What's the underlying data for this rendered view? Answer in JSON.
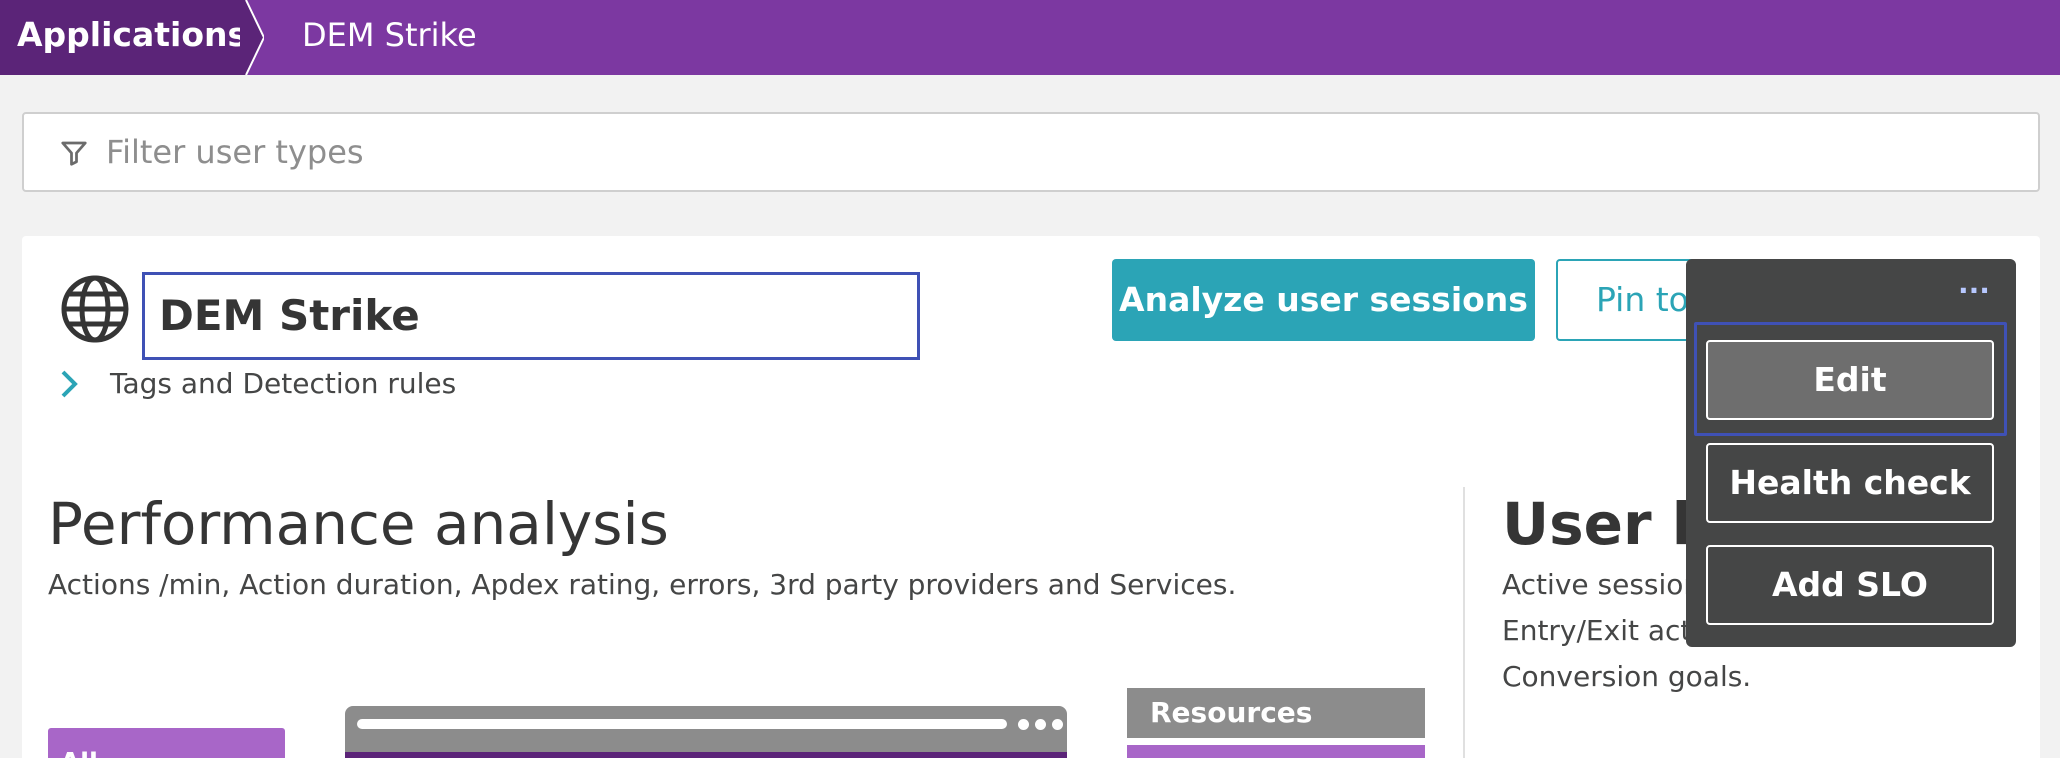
{
  "breadcrumb": {
    "root": "Applications",
    "current": "DEM Strike"
  },
  "filter": {
    "placeholder": "Filter user types",
    "value": ""
  },
  "app": {
    "name": "DEM Strike",
    "tags_label": "Tags and Detection rules"
  },
  "actions": {
    "analyze_label": "Analyze user sessions",
    "pin_label": "Pin to"
  },
  "performance": {
    "title": "Performance analysis",
    "description": "Actions /min, Action duration, Apdex rating, errors, 3rd party providers and Services."
  },
  "user_behavior": {
    "title": "User be",
    "lines": [
      "Active session",
      "Entry/Exit act",
      "Conversion goals."
    ]
  },
  "illustration": {
    "left_label": "All",
    "resources_label": "Resources"
  },
  "menu": {
    "more_glyph": "···",
    "items": [
      "Edit",
      "Health check",
      "Add SLO"
    ]
  },
  "colors": {
    "brand_purple": "#7c38a1",
    "brand_purple_dark": "#5b2478",
    "accent_teal": "#2ba4b6",
    "focus_blue": "#3f51b5",
    "menu_bg": "#454646"
  },
  "icons": {
    "filter": "filter-icon",
    "globe": "globe-icon",
    "tags_chevron": "chevron-right-icon",
    "more": "more-icon"
  }
}
